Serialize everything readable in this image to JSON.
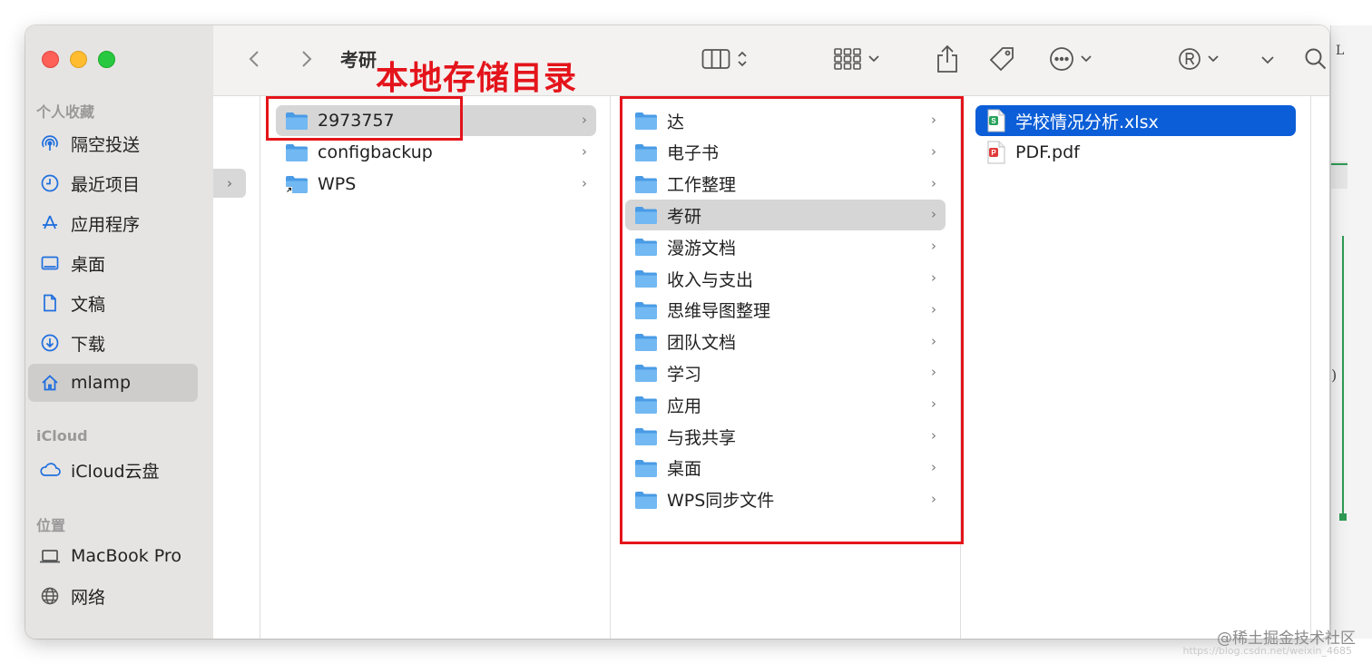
{
  "window": {
    "title": "考研"
  },
  "annotation": {
    "label": "本地存储目录"
  },
  "sidebar": {
    "favorites_header": "个人收藏",
    "favorites": [
      {
        "label": "隔空投送",
        "icon": "airdrop-icon"
      },
      {
        "label": "最近项目",
        "icon": "clock-icon"
      },
      {
        "label": "应用程序",
        "icon": "applications-icon"
      },
      {
        "label": "桌面",
        "icon": "desktop-icon"
      },
      {
        "label": "文稿",
        "icon": "document-icon"
      },
      {
        "label": "下载",
        "icon": "download-icon"
      },
      {
        "label": "mlamp",
        "icon": "home-icon"
      }
    ],
    "icloud_header": "iCloud",
    "icloud": [
      {
        "label": "iCloud云盘",
        "icon": "cloud-icon"
      }
    ],
    "locations_header": "位置",
    "locations": [
      {
        "label": "MacBook Pro",
        "icon": "laptop-icon"
      },
      {
        "label": "网络",
        "icon": "globe-icon"
      }
    ]
  },
  "columns": {
    "col1": [
      "2973757",
      "configbackup",
      "WPS"
    ],
    "col2": [
      "达",
      "电子书",
      "工作整理",
      "考研",
      "漫游文档",
      "收入与支出",
      "思维导图整理",
      "团队文档",
      "学习",
      "应用",
      "与我共享",
      "桌面",
      "WPS同步文件"
    ],
    "col3": [
      "学校情况分析.xlsx",
      "PDF.pdf"
    ]
  },
  "watermark": {
    "text": "@稀土掘金技术社区",
    "subtext": "https://blog.csdn.net/weixin_4685"
  },
  "colors": {
    "accent": "#0b5ed7",
    "annotation": "#e4141b",
    "folder": "#5aa9ec"
  }
}
